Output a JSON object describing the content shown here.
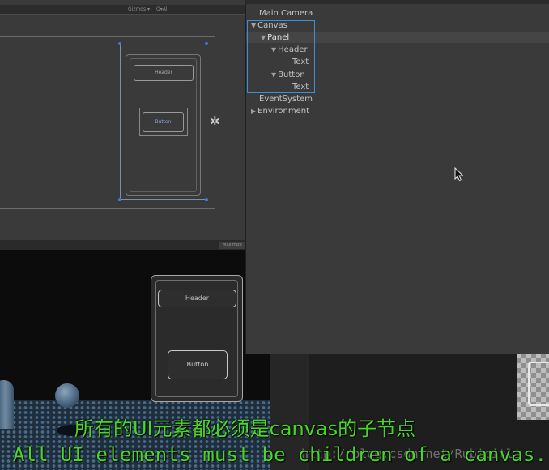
{
  "scene_toolbar": {
    "gizmos_label": "Gizmos ▾",
    "search_label": "Q▾All"
  },
  "scene": {
    "header_label": "Header",
    "button_label": "Button",
    "pivot_icon": "move-pivot-icon"
  },
  "game_tab": {
    "label": "Maximize"
  },
  "game": {
    "header_label": "Header",
    "button_label": "Button"
  },
  "hierarchy": {
    "items": [
      {
        "label": "Main Camera",
        "expanded": null
      },
      {
        "label": "Canvas",
        "expanded": true
      },
      {
        "label": "Panel",
        "expanded": true
      },
      {
        "label": "Header",
        "expanded": true
      },
      {
        "label": "Text",
        "expanded": null
      },
      {
        "label": "Button",
        "expanded": true
      },
      {
        "label": "Text",
        "expanded": null
      },
      {
        "label": "EventSystem",
        "expanded": null
      },
      {
        "label": "Environment",
        "expanded": false
      }
    ],
    "selection_color": "#3b8fd8",
    "expanded_arrow": "▼",
    "collapsed_arrow": "▶"
  },
  "subtitles": {
    "zh": "所有的UI元素都必须是canvas的子节点",
    "en": "All UI elements must be children of a canvas.",
    "color": "#4bd62a"
  },
  "watermark": "http://blog.csdn.net/Rubicitli"
}
